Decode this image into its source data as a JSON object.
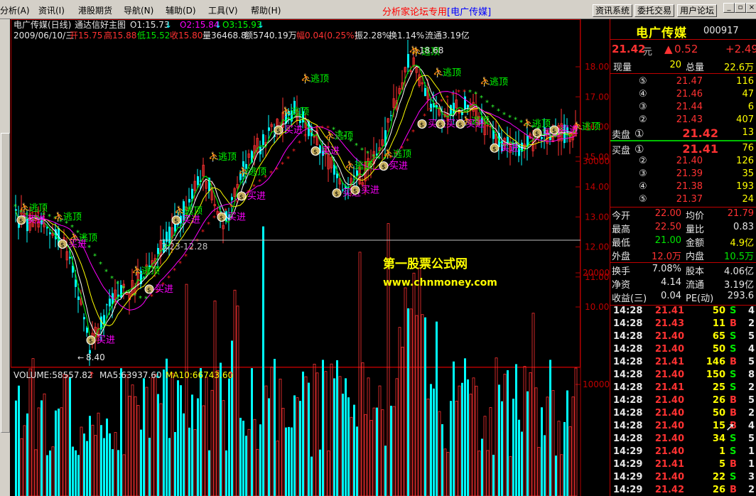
{
  "menu": {
    "items": [
      "分析(A)",
      "资讯(I)",
      "港股期货",
      "导航(N)",
      "辅助(D)",
      "工具(V)",
      "帮助(H)"
    ],
    "forum_prefix": "分析家论坛专用",
    "forum_name": "[电广传媒]",
    "buttons": [
      "资讯系统",
      "委托交易",
      "用户论坛"
    ]
  },
  "chart": {
    "title": "电广传媒(日线)",
    "formula": "通达信好主图",
    "o1": "O1:15.73",
    "o2": "O2:15.84",
    "o3": "O3:15.93",
    "info_date": "2009/06/10/三",
    "info_open": "开15.75",
    "info_high": "高15.88",
    "info_low": "低15.52",
    "info_close": "收15.80",
    "info_vol": "量36468.8",
    "info_amt": "额5740.19万",
    "info_chg": "幅0.04(0.25%)",
    "info_amp": "振2.28%",
    "info_turn": "换1.14%",
    "info_float": "流通3.19亿",
    "price_axis": [
      "18.00",
      "17.00",
      "16.00",
      "15.00",
      "14.00",
      "13.00",
      "12.00",
      "11.00",
      "10.00"
    ],
    "label_high": "18.68",
    "label_low": "8.40",
    "label_range": "3.23-12.28",
    "escape_label": "逃顶",
    "buy_label": "买进",
    "watermark_1": "第一股票公式网",
    "watermark_2": "www.chnmoney.com",
    "vol_title": "VOLUME:58557.82",
    "vol_ma5": "MA5:63937.60",
    "vol_ma10": "MA10:66743.60",
    "vol_axis": [
      "30000",
      "20000",
      "10000"
    ]
  },
  "quote": {
    "name": "电广传媒",
    "code": "000917",
    "price": "21.42",
    "price_unit": "元",
    "change": "0.52",
    "change_pct": "+2.49",
    "now_vol_label": "现量",
    "now_vol": "20",
    "total_vol_label": "总量",
    "total_vol": "22.6万",
    "sell_label": "卖盘",
    "buy_label": "买盘",
    "asks": [
      {
        "lv": "⑤",
        "p": "21.47",
        "v": "116"
      },
      {
        "lv": "④",
        "p": "21.46",
        "v": "47"
      },
      {
        "lv": "③",
        "p": "21.44",
        "v": "6"
      },
      {
        "lv": "②",
        "p": "21.43",
        "v": "407"
      },
      {
        "lv": "①",
        "p": "21.42",
        "v": "13"
      }
    ],
    "bids": [
      {
        "lv": "①",
        "p": "21.41",
        "v": "76"
      },
      {
        "lv": "②",
        "p": "21.40",
        "v": "126"
      },
      {
        "lv": "③",
        "p": "21.39",
        "v": "35"
      },
      {
        "lv": "④",
        "p": "21.38",
        "v": "193"
      },
      {
        "lv": "⑤",
        "p": "21.37",
        "v": "24"
      }
    ],
    "stats": [
      {
        "l1": "今开",
        "v1": "22.00",
        "l2": "均价",
        "v2": "21.79"
      },
      {
        "l1": "最高",
        "v1": "22.50",
        "l2": "量比",
        "v2": "0.83"
      },
      {
        "l1": "最低",
        "v1": "21.00",
        "l2": "金额",
        "v2": "4.9亿"
      },
      {
        "l1": "外盘",
        "v1": "12.0万",
        "l2": "内盘",
        "v2": "10.5万"
      }
    ],
    "fund": [
      {
        "l1": "换手",
        "v1": "7.08%",
        "l2": "股本",
        "v2": "4.06亿"
      },
      {
        "l1": "净资",
        "v1": "4.14",
        "l2": "流通",
        "v2": "3.19亿"
      },
      {
        "l1": "收益(三)",
        "v1": "0.04",
        "l2": "PE(动)",
        "v2": "293.6"
      }
    ],
    "ticks": [
      {
        "t": "14:28",
        "p": "21.41",
        "v": "50",
        "s": "S",
        "n": "4"
      },
      {
        "t": "14:28",
        "p": "21.43",
        "v": "11",
        "s": "B",
        "n": "2"
      },
      {
        "t": "14:28",
        "p": "21.40",
        "v": "65",
        "s": "S",
        "n": "5"
      },
      {
        "t": "14:28",
        "p": "21.40",
        "v": "50",
        "s": "S",
        "n": "4"
      },
      {
        "t": "14:28",
        "p": "21.41",
        "v": "146",
        "s": "B",
        "n": "5"
      },
      {
        "t": "14:28",
        "p": "21.40",
        "v": "150",
        "s": "S",
        "n": "8"
      },
      {
        "t": "14:28",
        "p": "21.41",
        "v": "25",
        "s": "S",
        "n": "2"
      },
      {
        "t": "14:28",
        "p": "21.40",
        "v": "26",
        "s": "B",
        "n": "5"
      },
      {
        "t": "14:28",
        "p": "21.40",
        "v": "50",
        "s": "B",
        "n": "2"
      },
      {
        "t": "14:28",
        "p": "21.40",
        "v": "15",
        "s": "B",
        "n": "4"
      },
      {
        "t": "14:28",
        "p": "21.40",
        "v": "34",
        "s": "S",
        "n": "5"
      },
      {
        "t": "14:29",
        "p": "21.40",
        "v": "1",
        "s": "S",
        "n": "1"
      },
      {
        "t": "14:29",
        "p": "21.41",
        "v": "5",
        "s": "B",
        "n": "1"
      },
      {
        "t": "14:29",
        "p": "21.40",
        "v": "22",
        "s": "S",
        "n": "3"
      },
      {
        "t": "14:29",
        "p": "21.42",
        "v": "26",
        "s": "B",
        "n": "2"
      }
    ]
  }
}
